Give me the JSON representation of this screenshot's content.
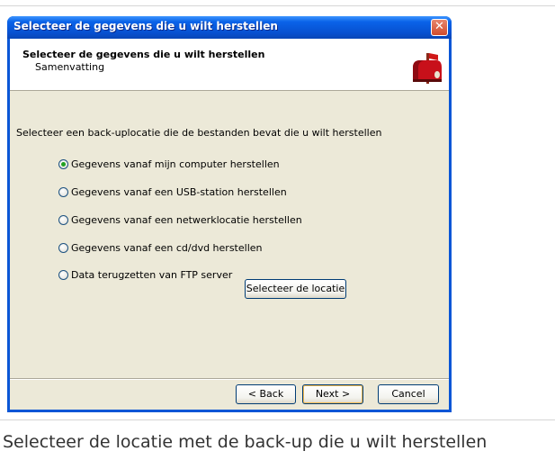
{
  "window": {
    "title": "Selecteer de gegevens die u wilt herstellen",
    "close_glyph": "✕"
  },
  "header": {
    "title": "Selecteer de gegevens die u wilt herstellen",
    "subtitle": "Samenvatting",
    "icon": "mailbox-icon"
  },
  "body": {
    "prompt": "Selecteer een back-uplocatie die de bestanden bevat die u wilt herstellen",
    "options": [
      {
        "label": "Gegevens vanaf mijn computer herstellen",
        "checked": true
      },
      {
        "label": "Gegevens vanaf een USB-station herstellen",
        "checked": false
      },
      {
        "label": "Gegevens vanaf een netwerklocatie herstellen",
        "checked": false
      },
      {
        "label": "Gegevens vanaf een cd/dvd herstellen",
        "checked": false
      },
      {
        "label": "Data terugzetten van FTP server",
        "checked": false
      }
    ],
    "select_location_label": "Selecteer de locatie"
  },
  "footer": {
    "back_label": "< Back",
    "next_label": "Next >",
    "cancel_label": "Cancel"
  },
  "caption": "Selecteer de locatie met de back-up die u wilt herstellen"
}
